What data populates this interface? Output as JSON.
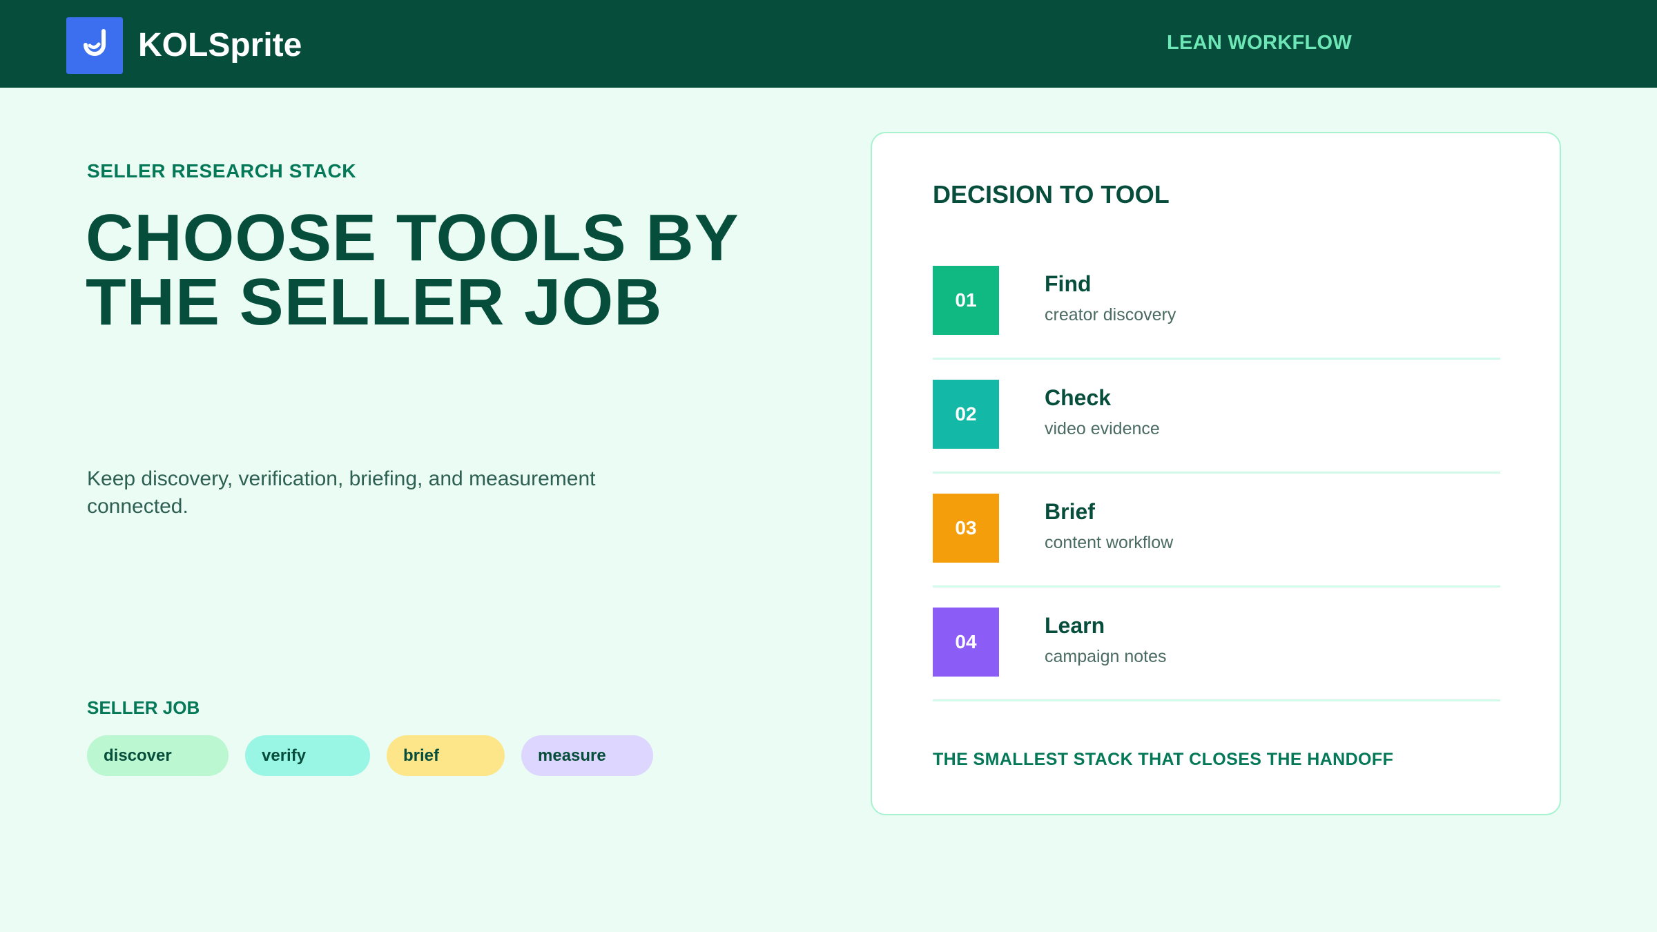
{
  "header": {
    "brand": "KOLSprite",
    "right_label": "LEAN WORKFLOW",
    "logo_icon": "kolsprite-logo-icon"
  },
  "hero": {
    "eyebrow": "SELLER RESEARCH STACK",
    "headline_line1": "CHOOSE TOOLS BY",
    "headline_line2": "THE SELLER JOB",
    "description": "Keep discovery, verification, briefing, and measurement connected."
  },
  "seller_job": {
    "label": "SELLER JOB",
    "chips": [
      {
        "label": "discover",
        "color": "#bbf7d0"
      },
      {
        "label": "verify",
        "color": "#99f6e4"
      },
      {
        "label": "brief",
        "color": "#fde68a"
      },
      {
        "label": "measure",
        "color": "#ddd6fe"
      }
    ]
  },
  "decision_card": {
    "title": "DECISION TO TOOL",
    "steps": [
      {
        "num": "01",
        "name": "Find",
        "sub": "creator discovery",
        "color": "#10b981"
      },
      {
        "num": "02",
        "name": "Check",
        "sub": "video evidence",
        "color": "#14b8a6"
      },
      {
        "num": "03",
        "name": "Brief",
        "sub": "content workflow",
        "color": "#f59e0b"
      },
      {
        "num": "04",
        "name": "Learn",
        "sub": "campaign notes",
        "color": "#8b5cf6"
      }
    ],
    "footer": "THE SMALLEST STACK THAT CLOSES THE HANDOFF"
  },
  "colors": {
    "header_bg": "#064e3b",
    "page_bg": "#eafcf3",
    "accent": "#047857",
    "logo_bg": "#3b6ff0"
  }
}
